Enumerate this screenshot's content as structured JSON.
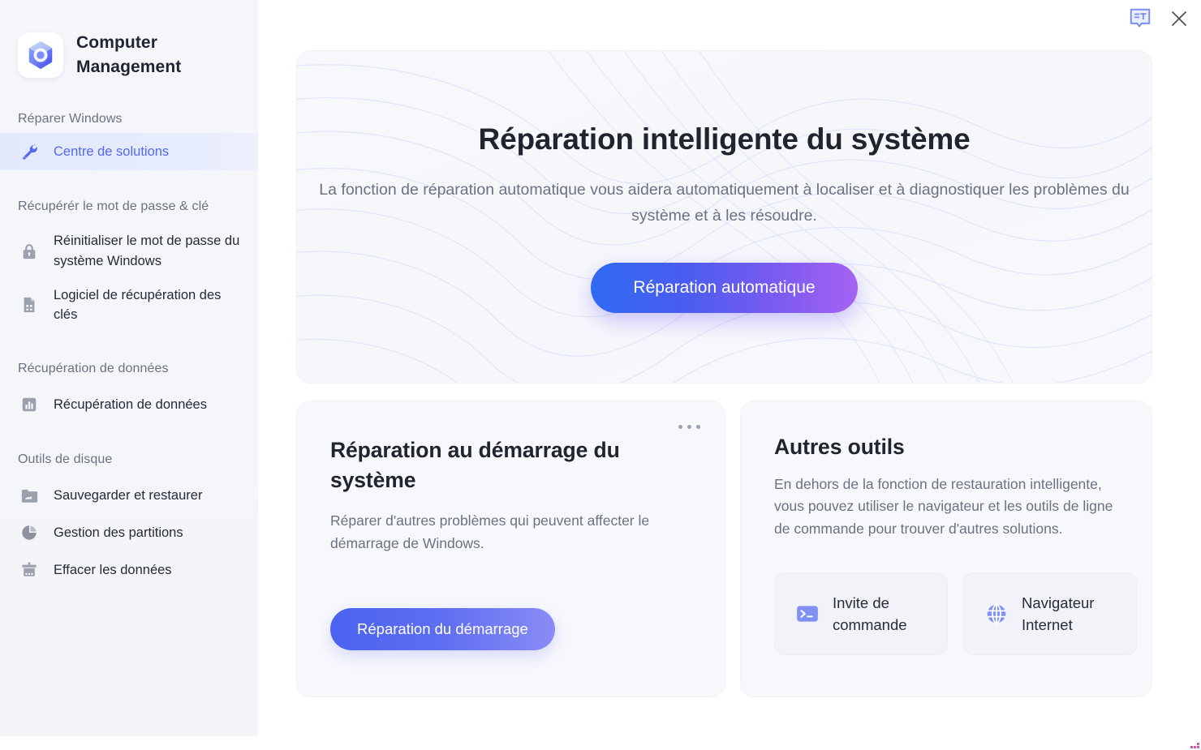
{
  "app": {
    "title": "Computer\nManagement",
    "title_line1": "Computer",
    "title_line2": "Management",
    "logo_icon": "hex-nut-logo-icon"
  },
  "topbar": {
    "translate_icon": "translate-bubble-icon",
    "close_icon": "close-icon"
  },
  "sidebar": {
    "groups": [
      {
        "label": "Réparer Windows",
        "items": [
          {
            "label": "Centre de solutions",
            "icon": "wrench-icon",
            "active": true
          }
        ]
      },
      {
        "label": "Récupérér le mot de passe  & clé",
        "items": [
          {
            "label": "Réinitialiser le mot de passe du système Windows",
            "icon": "lock-icon",
            "active": false
          },
          {
            "label": "Logiciel de récupération des clés",
            "icon": "document-key-icon",
            "active": false
          }
        ]
      },
      {
        "label": "Récupération de données",
        "items": [
          {
            "label": "Récupération de données",
            "icon": "bar-chart-icon",
            "active": false
          }
        ]
      },
      {
        "label": "Outils de disque",
        "items": [
          {
            "label": "Sauvegarder et restaurer",
            "icon": "folder-backup-icon",
            "active": false
          },
          {
            "label": "Gestion des partitions",
            "icon": "pie-chart-icon",
            "active": false
          },
          {
            "label": "Effacer les données",
            "icon": "trash-wipe-icon",
            "active": false
          }
        ]
      }
    ]
  },
  "hero": {
    "title": "Réparation intelligente du système",
    "subtitle": "La fonction de réparation automatique vous aidera automatiquement à localiser et à diagnostiquer les problèmes du système et à les résoudre.",
    "cta_label": "Réparation automatique"
  },
  "cards": {
    "startup_repair": {
      "title": "Réparation au démarrage du système",
      "description": "Réparer d'autres problèmes qui peuvent affecter le démarrage de Windows.",
      "button_label": "Réparation du démarrage",
      "menu_icon": "more-options-icon"
    },
    "other_tools": {
      "title": "Autres outils",
      "description": "En dehors de la fonction de restauration intelligente, vous pouvez utiliser le navigateur et les outils de ligne de commande pour trouver d'autres solutions.",
      "tools": [
        {
          "label": "Invite de commande",
          "label_line1": "Invite de",
          "label_line2": "commande",
          "icon": "terminal-icon"
        },
        {
          "label": "Navigateur Internet",
          "label_line1": "Navigateur",
          "label_line2": "Internet",
          "icon": "globe-icon"
        }
      ]
    }
  },
  "colors": {
    "accent_blue": "#5468f0",
    "accent_purple": "#a563f2",
    "sidebar_bg": "#f5f6fa",
    "card_bg": "#f7f8fc",
    "active_nav_bg": "#e2e9fc",
    "text_primary": "#20242e",
    "text_muted": "#6b7280"
  }
}
